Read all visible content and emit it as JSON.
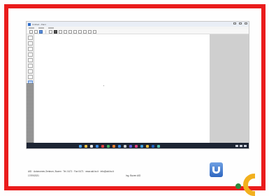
{
  "app": {
    "title": "Untitled - Paint",
    "accent_color": "#2e6cc8",
    "frame_color": "#ea1c1c"
  },
  "toolbar": {
    "icons": [
      "new-icon",
      "open-icon",
      "save-icon",
      "pencil-icon",
      "brush-icon",
      "line-icon",
      "curve-icon",
      "shape-icon",
      "text-icon",
      "select-icon"
    ]
  },
  "footer": {
    "institution": "AID · Autonomes Zentrum, Bozen · Tel. 0471 · Fax 0471 · www.aid.bz.it · info@aid.bz.it",
    "date": "17/09/2021",
    "author": "Ing. Bozen AID"
  },
  "taskbar": {
    "icon_colors": [
      "#4aa3f0",
      "#f0c040",
      "#e8e8e8",
      "#3c8ee8",
      "#e04040",
      "#40b060",
      "#f08030",
      "#3c8ee8",
      "#d0d0d0",
      "#6060e0",
      "#e04080",
      "#40a0e0",
      "#f0c040",
      "#2060c0",
      "#50c0b0"
    ]
  }
}
